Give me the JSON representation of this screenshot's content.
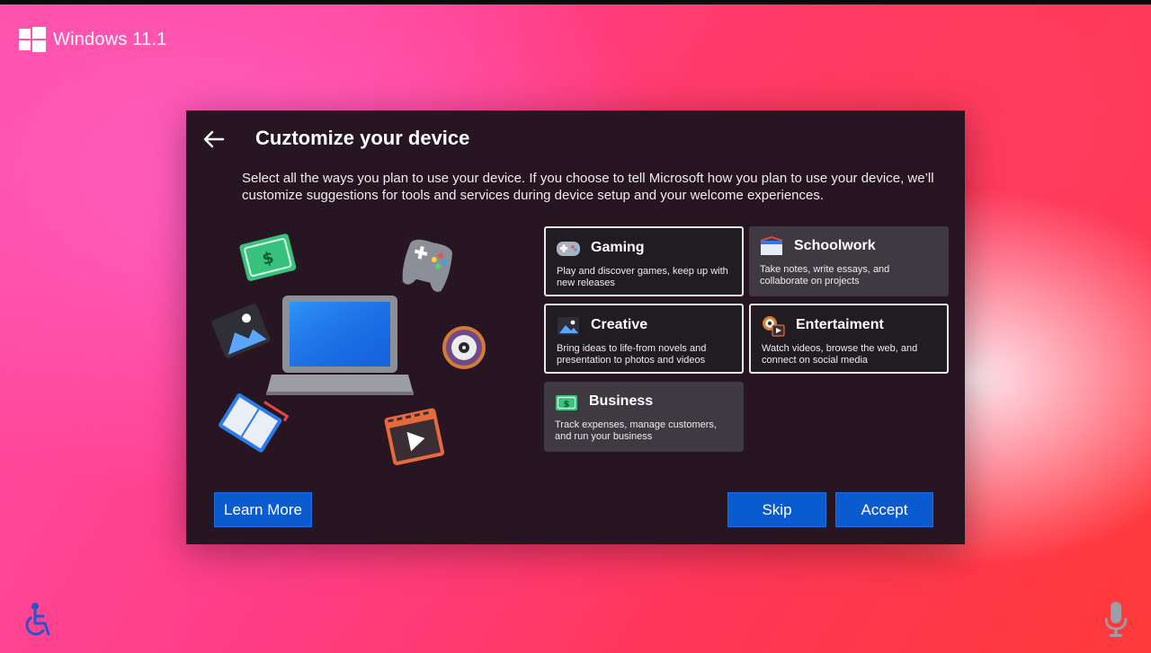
{
  "brand": {
    "label": "Windows 11.1"
  },
  "dialog": {
    "title": "Cuztomize your device",
    "description": "Select all the ways you plan to use your device. If you choose to tell Microsoft how you plan to use your device, we’ll customize suggestions for tools and services during device setup and your welcome experiences."
  },
  "options": [
    {
      "name": "Gaming",
      "description": "Play and discover games, keep up with new releases",
      "icon": "gamepad-icon",
      "selected": true
    },
    {
      "name": "Schoolwork",
      "description": "Take notes, write essays, and collaborate on projects",
      "icon": "notebook-icon",
      "selected": false
    },
    {
      "name": "Creative",
      "description": "Bring ideas to life-from novels and presentation to photos and videos",
      "icon": "photo-icon",
      "selected": true
    },
    {
      "name": "Entertaiment",
      "description": "Watch videos, browse the web, and connect on social media",
      "icon": "media-icon",
      "selected": true
    },
    {
      "name": "Business",
      "description": "Track expenses, manage customers, and run your business",
      "icon": "money-icon",
      "selected": false
    }
  ],
  "buttons": {
    "learn_more": "Learn More",
    "skip": "Skip",
    "accept": "Accept"
  },
  "colors": {
    "accent": "#0b5bd0",
    "dialog_bg": "#281522",
    "card_bg": "#3f3a41"
  }
}
